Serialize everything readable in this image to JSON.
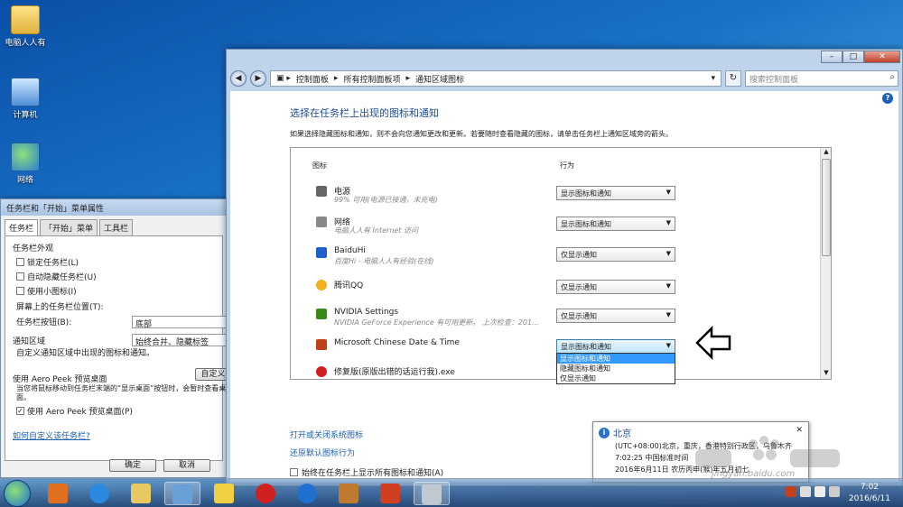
{
  "desktop": {
    "icons": [
      {
        "label": "电脑人人有",
        "icon": "folder-icon"
      },
      {
        "label": "计算机",
        "icon": "computer-icon"
      },
      {
        "label": "网络",
        "icon": "network-icon"
      }
    ]
  },
  "props_window": {
    "title": "任务栏和「开始」菜单属性",
    "tabs": [
      "任务栏",
      "「开始」菜单",
      "工具栏"
    ],
    "appearance_group": "任务栏外观",
    "lock_taskbar": "锁定任务栏(L)",
    "autohide": "自动隐藏任务栏(U)",
    "small_icons": "使用小图标(I)",
    "position_label": "屏幕上的任务栏位置(T):",
    "position_value": "底部",
    "buttons_label": "任务栏按钮(B):",
    "buttons_value": "始终合并、隐藏标签",
    "notify_group": "通知区域",
    "notify_desc": "自定义通知区域中出现的图标和通知。",
    "customize_btn": "自定义",
    "aero_group": "使用 Aero Peek 预览桌面",
    "aero_desc": "当您将鼠标移动到任务栏末端的“显示桌面”按钮时，会暂时查看桌面。",
    "aero_check": "使用 Aero Peek 预览桌面(P)",
    "help_link": "如何自定义该任务栏?",
    "ok": "确定",
    "cancel": "取消"
  },
  "cp_window": {
    "breadcrumb": [
      "控制面板",
      "所有控制面板项",
      "通知区域图标"
    ],
    "search_placeholder": "搜索控制面板",
    "title": "选择在任务栏上出现的图标和通知",
    "desc": "如果选择隐藏图标和通知，则不会向您通知更改和更新。若要随时查看隐藏的图标，请单击任务栏上通知区域旁的箭头。",
    "col_icon": "图标",
    "col_behavior": "行为",
    "items": [
      {
        "name": "电源",
        "sub": "99% 可用(电源已接通，未充电)",
        "behavior": "显示图标和通知",
        "icon": "power-icon",
        "color": "#666666"
      },
      {
        "name": "网络",
        "sub": "电脑人人有 Internet 访问",
        "behavior": "显示图标和通知",
        "icon": "network-signal-icon",
        "color": "#888888"
      },
      {
        "name": "BaiduHi",
        "sub": "百度Hi - 电脑人人有经验(在线)",
        "behavior": "仅显示通知",
        "icon": "baiduhi-icon",
        "color": "#1e5fd0"
      },
      {
        "name": "腾讯QQ",
        "sub": "",
        "behavior": "仅显示通知",
        "icon": "qq-icon",
        "color": "#f0b020"
      },
      {
        "name": "NVIDIA Settings",
        "sub": "NVIDIA GeForce Experience 有可用更新。 上次检查：201...",
        "behavior": "仅显示通知",
        "icon": "nvidia-icon",
        "color": "#3a8a1a"
      },
      {
        "name": "Microsoft Chinese Date & Time",
        "sub": "",
        "behavior": "显示图标和通知",
        "icon": "calendar-icon",
        "color": "#c0401a"
      },
      {
        "name": "修复版(原版出错的话运行我).exe",
        "sub": "",
        "behavior": "",
        "icon": "exe-icon",
        "color": "#d02020"
      }
    ],
    "dropdown_options": [
      "显示图标和通知",
      "隐藏图标和通知",
      "仅显示通知"
    ],
    "link_toggle": "打开或关闭系统图标",
    "link_restore": "还原默认图标行为",
    "always_show": "始终在任务栏上显示所有图标和通知(A)"
  },
  "balloon": {
    "title": "北京",
    "lines": [
      "(UTC+08:00)北京，重庆，香港特别行政区，乌鲁木齐",
      "7:02:25  中国标准时间",
      "2016年6月11日 农历丙申(猴)年五月初七"
    ]
  },
  "watermark": "jingyan.baidu.com",
  "clock": {
    "time": "7:02",
    "date": "2016/6/11"
  }
}
